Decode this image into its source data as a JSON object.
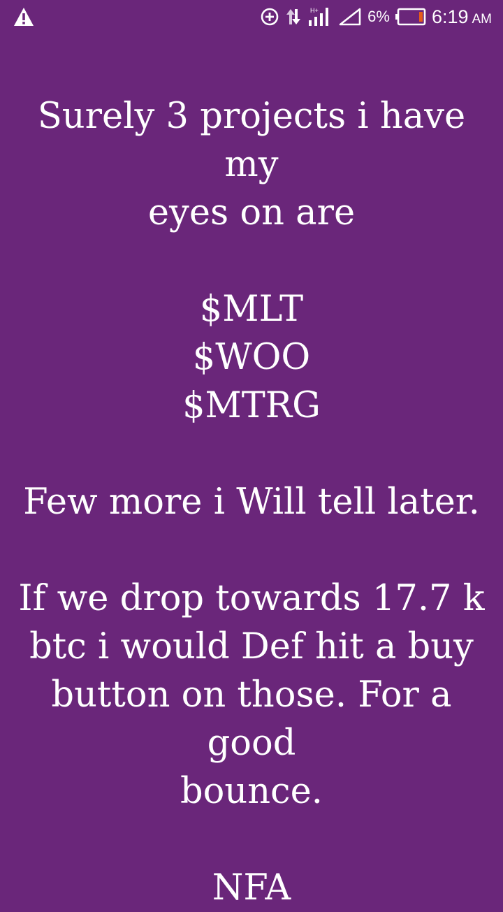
{
  "status_bar": {
    "battery_percent": "6%",
    "time": "6:19",
    "ampm": "AM",
    "network_type": "H+",
    "icons": [
      "warning-icon",
      "data-saver-icon",
      "data-transfer-icon",
      "cell-signal-icon",
      "wifi-signal-icon",
      "battery-icon"
    ],
    "battery_low_color": "#e65c1a"
  },
  "post": {
    "background_color": "#6a267a",
    "text_color": "#ffffff",
    "intro": [
      "Surely 3 projects i have my",
      "eyes on are"
    ],
    "tickers": [
      "$MLT",
      "$WOO",
      "$MTRG"
    ],
    "more": "Few more i Will tell later.",
    "plan": [
      "If we drop towards 17.7 k",
      "btc i would Def hit a buy",
      "button on those. For a good",
      "bounce."
    ],
    "disclaimer": "NFA"
  }
}
